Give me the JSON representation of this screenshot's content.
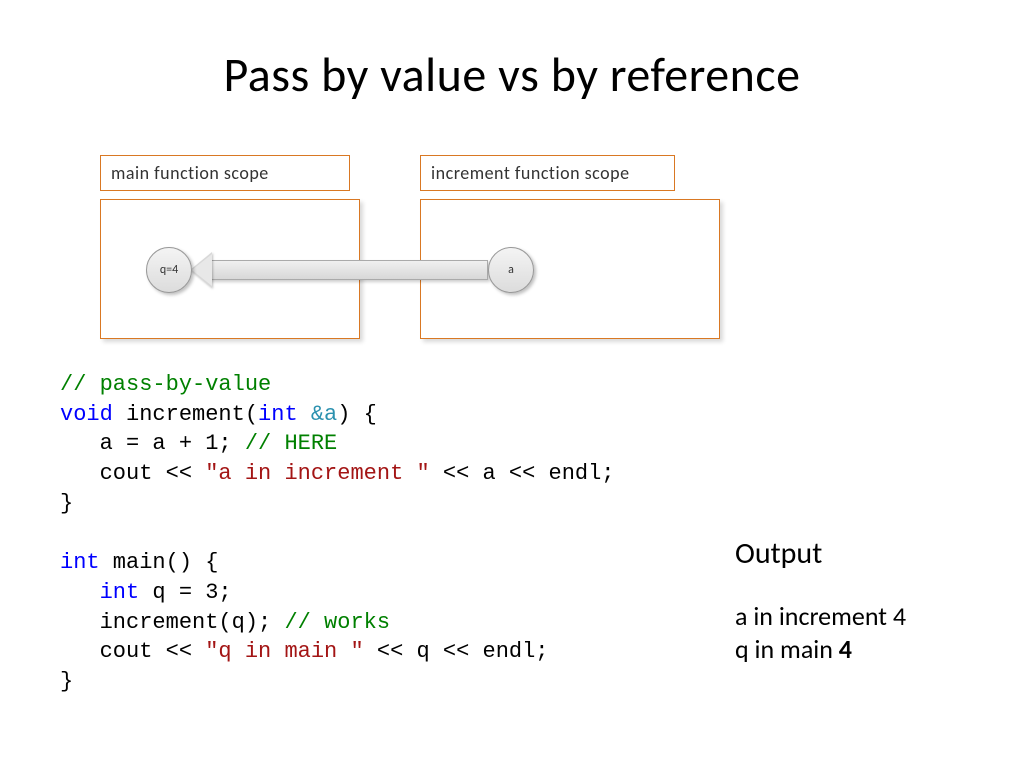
{
  "title": "Pass by value vs by reference",
  "diagram": {
    "main_scope_label": "main function scope",
    "inc_scope_label": "increment function scope",
    "var_q": "q=4",
    "var_a": "a"
  },
  "code": {
    "c1": "// pass-by-value",
    "kw_void": "void",
    "fn_name": " increment(",
    "kw_int1": "int",
    "amp_a": " &a",
    "paren_close": ") {",
    "body1_pre": "   a = a + 1; ",
    "body1_cmt": "// HERE",
    "body2_pre": "   cout << ",
    "str1": "\"a in increment \"",
    "body2_post": " << a << endl;",
    "close1": "}",
    "kw_int2": "int",
    "main_decl": " main() {",
    "kw_int3": "int",
    "q_decl": " q = 3;",
    "call_pre": "   increment(q); ",
    "call_cmt": "// works",
    "cout2_pre": "   cout << ",
    "str2": "\"q in main \"",
    "cout2_post": " << q << endl;",
    "close2": "}"
  },
  "output": {
    "heading": "Output",
    "line1_text": "a in increment ",
    "line1_val": "4",
    "line2_text": "q in main ",
    "line2_val": "4"
  }
}
